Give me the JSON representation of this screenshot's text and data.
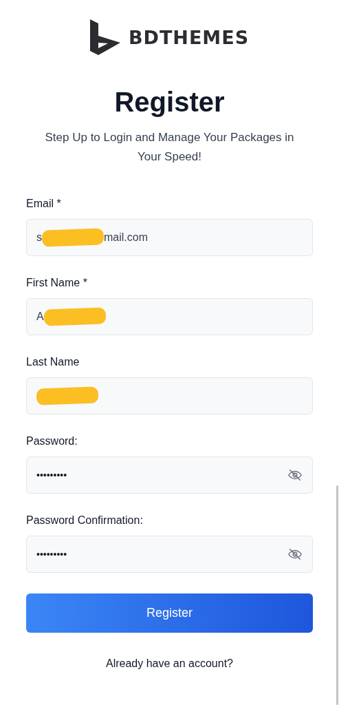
{
  "logo": {
    "text": "BDTHEMES"
  },
  "title": "Register",
  "subtitle": "Step Up to Login and Manage Your Packages in Your Speed!",
  "fields": [
    {
      "label": "Email *",
      "kind": "text",
      "value_parts": [
        {
          "kind": "text",
          "text": "s"
        },
        {
          "kind": "redacted"
        },
        {
          "kind": "text",
          "text": "mail.com"
        }
      ]
    },
    {
      "label": "First Name *",
      "kind": "text",
      "value_parts": [
        {
          "kind": "text",
          "text": "A"
        },
        {
          "kind": "redacted"
        }
      ]
    },
    {
      "label": "Last Name",
      "kind": "text",
      "value_parts": [
        {
          "kind": "redacted"
        }
      ]
    },
    {
      "label": "Password:",
      "kind": "password",
      "value": "•••••••••"
    },
    {
      "label": "Password Confirmation:",
      "kind": "password",
      "value": "•••••••••"
    }
  ],
  "submit_button": "Register",
  "login_link": "Already have an account?"
}
